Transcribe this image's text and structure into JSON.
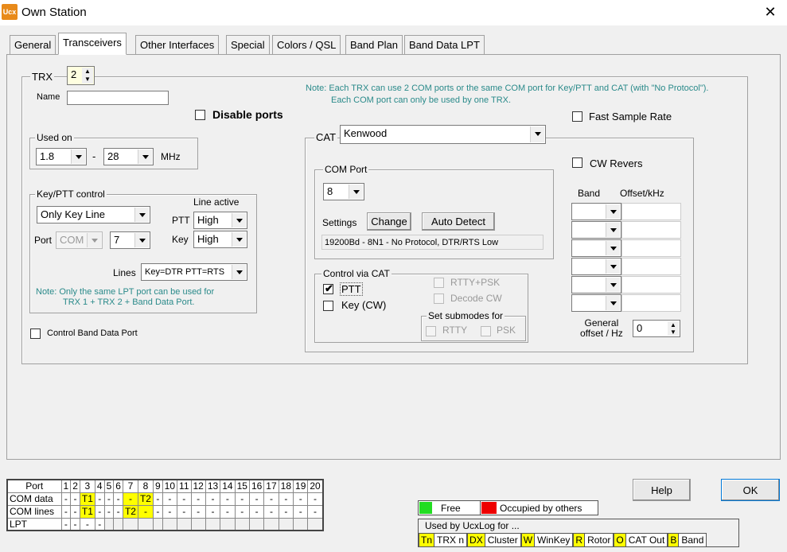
{
  "window": {
    "title": "Own Station",
    "app_icon": "ucx-logo-icon",
    "close": "✕"
  },
  "tabs": [
    "General",
    "Transceivers",
    "Other Interfaces",
    "Special",
    "Colors / QSL",
    "Band Plan",
    "Band Data LPT"
  ],
  "trx": {
    "label": "TRX",
    "value": "2",
    "name_label": "Name",
    "name_value": "",
    "disable_ports": "Disable ports",
    "note": [
      "Note: Each TRX can use 2 COM ports or the same COM port for Key/PTT and CAT (with \"No Protocol\").",
      "Each COM port can only be used by one TRX."
    ],
    "fast_sample": "Fast Sample Rate"
  },
  "used_on": {
    "legend": "Used on",
    "from": "1.8",
    "sep": "-",
    "to": "28",
    "unit": "MHz"
  },
  "keyptt": {
    "legend": "Key/PTT control",
    "mode": "Only Key Line",
    "line_active": "Line active",
    "ptt_label": "PTT",
    "ptt_value": "High",
    "key_label": "Key",
    "key_value": "High",
    "port_label": "Port",
    "port_type": "COM",
    "port_num": "7",
    "lines_label": "Lines",
    "lines_value": "Key=DTR PTT=RTS",
    "note": [
      "Note: Only the same LPT port can be used for",
      "TRX 1 + TRX 2 + Band Data Port."
    ]
  },
  "control_band": "Control Band Data Port",
  "cat": {
    "label": "CAT",
    "value": "Kenwood",
    "com_legend": "COM Port",
    "com_value": "8",
    "settings_label": "Settings",
    "change": "Change",
    "auto_detect": "Auto Detect",
    "settings_text": "19200Bd - 8N1 - No Protocol, DTR/RTS Low",
    "control_legend": "Control via CAT",
    "ptt": "PTT",
    "key_cw": "Key (CW)",
    "rtty_psk": "RTTY+PSK",
    "decode_cw": "Decode CW",
    "submodes_legend": "Set submodes for",
    "rtty": "RTTY",
    "psk": "PSK",
    "cw_revers": "CW Revers",
    "band_col": "Band",
    "offset_col": "Offset/kHz",
    "general_offset": [
      "General",
      "offset / Hz"
    ],
    "general_offset_value": "0"
  },
  "port_table": {
    "header": [
      "Port",
      "1",
      "2",
      "3",
      "4",
      "5",
      "6",
      "7",
      "8",
      "9",
      "10",
      "11",
      "12",
      "13",
      "14",
      "15",
      "16",
      "17",
      "18",
      "19",
      "20"
    ],
    "rows": [
      {
        "label": "COM data",
        "cells": [
          "-",
          "-",
          "T1",
          "-",
          "-",
          "-",
          "-",
          "T2",
          "-",
          "-",
          "-",
          "-",
          "-",
          "-",
          "-",
          "-",
          "-",
          "-",
          "-",
          "-"
        ]
      },
      {
        "label": "COM lines",
        "cells": [
          "-",
          "-",
          "T1",
          "-",
          "-",
          "-",
          "T2",
          "-",
          "-",
          "-",
          "-",
          "-",
          "-",
          "-",
          "-",
          "-",
          "-",
          "-",
          "-",
          "-"
        ]
      },
      {
        "label": "LPT",
        "cells": [
          "-",
          "-",
          "-",
          "-",
          "",
          "",
          "",
          "",
          "",
          "",
          "",
          "",
          "",
          "",
          "",
          "",
          "",
          "",
          "",
          ""
        ]
      }
    ]
  },
  "legend": {
    "free": "Free",
    "occupied": "Occupied by others",
    "free_color": "#22dd22",
    "occupied_color": "#ee0000",
    "used_title": "Used by UcxLog for ...",
    "items": [
      [
        "Tn",
        "TRX n"
      ],
      [
        "DX",
        "Cluster"
      ],
      [
        "W",
        "WinKey"
      ],
      [
        "R",
        "Rotor"
      ],
      [
        "O",
        "CAT Out"
      ],
      [
        "B",
        "Band"
      ]
    ]
  },
  "buttons": {
    "help": "Help",
    "ok": "OK"
  }
}
